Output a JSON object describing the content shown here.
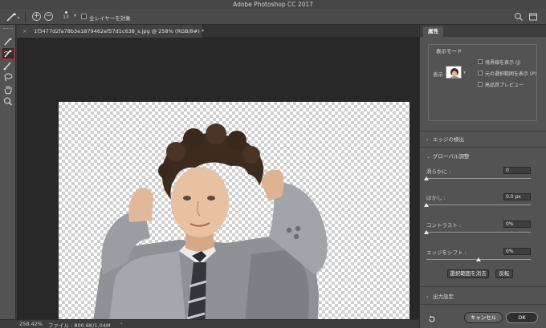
{
  "app": {
    "window_title": "Adobe Photoshop CC 2017"
  },
  "options_bar": {
    "brush_size": "13",
    "sample_all_layers_label": "全レイヤーを対象",
    "sample_all_layers_checked": false
  },
  "document": {
    "tab_title": "1f3477d2fa78b3e1879462ef57d1c638_s.jpg @ 258% (RGB/8#) *"
  },
  "status_bar": {
    "zoom": "258.42%",
    "file_info": "ファイル : 800.6K/1.04M"
  },
  "properties_panel": {
    "tab_label": "属性",
    "view_mode": {
      "group_title": "表示モード",
      "view_label": "表示 :",
      "options": [
        {
          "label": "境界線を表示 (J)",
          "checked": false
        },
        {
          "label": "元の選択範囲を表示 (P)",
          "checked": false
        },
        {
          "label": "高品質プレビュー",
          "checked": false
        }
      ]
    },
    "edge_detection": {
      "title": "エッジの検出",
      "expanded": false
    },
    "global_refinement": {
      "title": "グローバル調整",
      "expanded": true,
      "sliders": [
        {
          "label": "滑らかに :",
          "value": "0",
          "fraction": 0.0
        },
        {
          "label": "ぼかし :",
          "value": "0.0 px",
          "fraction": 0.0
        },
        {
          "label": "コントラスト :",
          "value": "0%",
          "fraction": 0.0
        },
        {
          "label": "エッジをシフト :",
          "value": "0%",
          "fraction": 0.5
        }
      ],
      "clear_selection_label": "選択範囲を消去",
      "invert_label": "反転"
    },
    "output_settings": {
      "title": "出力設定",
      "expanded": false
    },
    "cancel_label": "キャンセル",
    "ok_label": "OK"
  },
  "colors": {
    "active_tool_outline": "#d21c1c"
  }
}
